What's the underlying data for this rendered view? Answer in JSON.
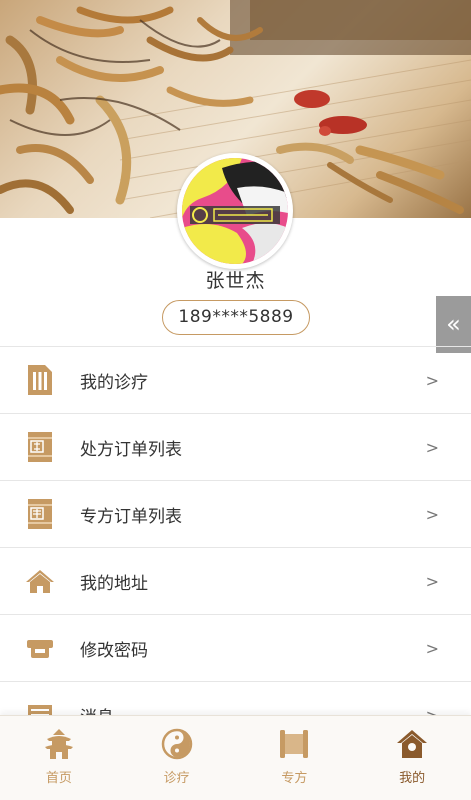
{
  "user": {
    "name": "张世杰",
    "phone": "189****5889"
  },
  "side_tab": {
    "glyph": "«"
  },
  "menu": [
    {
      "label": "我的诊疗",
      "arrow": ">",
      "icon": "list-document-icon"
    },
    {
      "label": "处方订单列表",
      "arrow": ">",
      "icon": "prescription-order-icon"
    },
    {
      "label": "专方订单列表",
      "arrow": ">",
      "icon": "special-formula-order-icon"
    },
    {
      "label": "我的地址",
      "arrow": ">",
      "icon": "home-address-icon"
    },
    {
      "label": "修改密码",
      "arrow": ">",
      "icon": "lock-password-icon"
    },
    {
      "label": "消息",
      "arrow": ">",
      "icon": "message-icon"
    }
  ],
  "tabs": [
    {
      "label": "首页",
      "icon": "pagoda-home-icon",
      "active": false
    },
    {
      "label": "诊疗",
      "icon": "yin-yang-icon",
      "active": false
    },
    {
      "label": "专方",
      "icon": "scroll-icon",
      "active": false
    },
    {
      "label": "我的",
      "icon": "house-profile-icon",
      "active": true
    }
  ],
  "colors": {
    "accent": "#c69a63",
    "accent_dark": "#8a5a2c",
    "side_tab": "#9b9b9b",
    "divider": "#e6e6e6"
  }
}
